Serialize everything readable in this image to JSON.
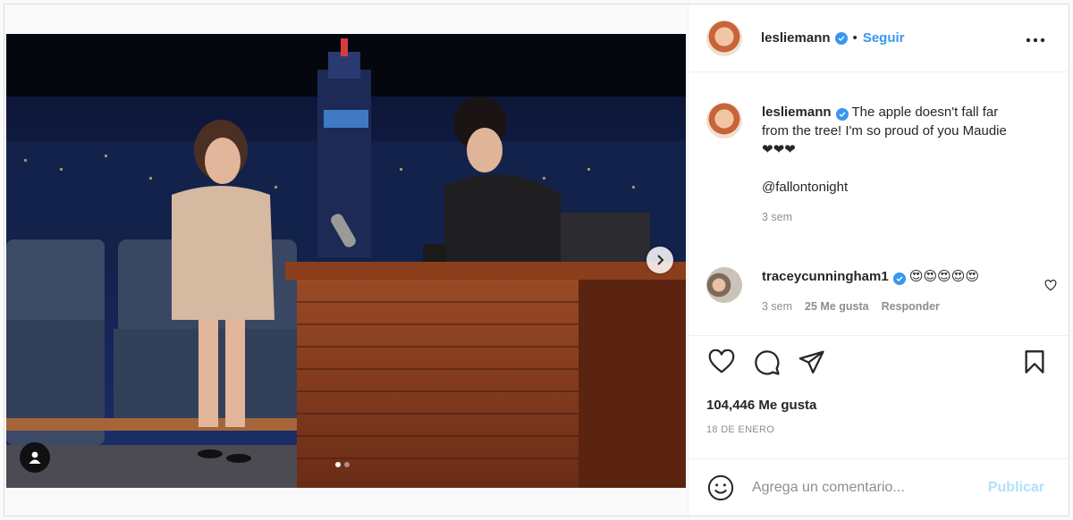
{
  "post": {
    "username": "lesliemann",
    "follow_label": "Seguir",
    "separator": "•"
  },
  "caption": {
    "username": "lesliemann",
    "text": "The apple doesn't fall far from the tree! I'm so proud of you Maudie❤❤❤",
    "mention": "@fallontonight",
    "time": "3 sem"
  },
  "comment": {
    "username": "traceycunningham1",
    "text": "😍😍😍😍😍",
    "time": "3 sem",
    "likes": "25 Me gusta",
    "reply_label": "Responder"
  },
  "stats": {
    "likes": "104,446 Me gusta",
    "date": "18 DE ENERO"
  },
  "composer": {
    "placeholder": "Agrega un comentario...",
    "publish_label": "Publicar"
  },
  "carousel": {
    "current": 1,
    "total": 2
  },
  "colors": {
    "accent": "#3897f0",
    "publish_disabled": "#b2dffc",
    "heart": "#ed4956"
  },
  "icons": [
    "tag-user-icon",
    "chevron-right-icon",
    "more-options-icon",
    "verified-icon",
    "heart-icon",
    "comment-icon",
    "share-icon",
    "bookmark-icon",
    "emoji-icon"
  ]
}
